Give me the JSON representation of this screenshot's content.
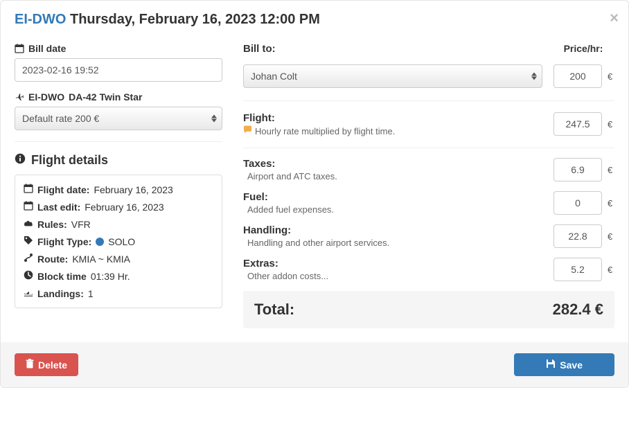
{
  "header": {
    "aircraft": "EI-DWO",
    "datetime": "Thursday, February 16, 2023 12:00 PM"
  },
  "bill_date": {
    "label": "Bill date",
    "value": "2023-02-16 19:52"
  },
  "aircraft_line": {
    "reg": "EI-DWO",
    "model": "DA-42 Twin Star"
  },
  "rate_select": {
    "selected": "Default rate 200 €"
  },
  "flight_details": {
    "heading": "Flight details",
    "flight_date_label": "Flight date:",
    "flight_date_value": "February 16, 2023",
    "last_edit_label": "Last edit:",
    "last_edit_value": "February 16, 2023",
    "rules_label": "Rules:",
    "rules_value": "VFR",
    "flight_type_label": "Flight Type:",
    "flight_type_value": "SOLO",
    "route_label": "Route:",
    "route_value": "KMIA ~ KMIA",
    "block_time_label": "Block time",
    "block_time_value": "01:39 Hr.",
    "landings_label": "Landings:",
    "landings_value": "1"
  },
  "bill_to": {
    "label": "Bill to:",
    "price_hr_label": "Price/hr:",
    "pilot_selected": "Johan Colt",
    "price_hr_value": "200",
    "currency": "€"
  },
  "costs": {
    "flight": {
      "title": "Flight:",
      "sub": "Hourly rate multiplied by flight time.",
      "value": "247.5"
    },
    "taxes": {
      "title": "Taxes:",
      "sub": "Airport and ATC taxes.",
      "value": "6.9"
    },
    "fuel": {
      "title": "Fuel:",
      "sub": "Added fuel expenses.",
      "value": "0"
    },
    "handling": {
      "title": "Handling:",
      "sub": "Handling and other airport services.",
      "value": "22.8"
    },
    "extras": {
      "title": "Extras:",
      "sub": "Other addon costs...",
      "value": "5.2"
    }
  },
  "total": {
    "label": "Total:",
    "value": "282.4 €"
  },
  "footer": {
    "delete_label": "Delete",
    "save_label": "Save"
  },
  "icons": {
    "info_bubble_color": "#f0ad4e"
  }
}
